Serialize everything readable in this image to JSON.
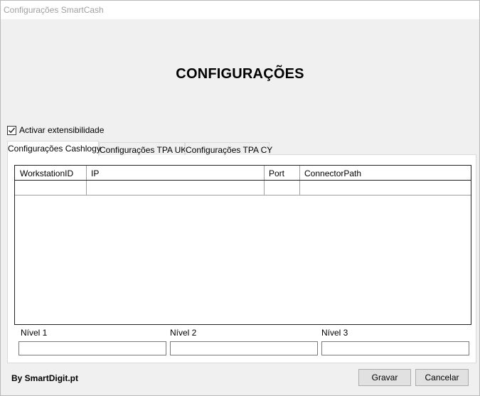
{
  "window": {
    "title": "Configurações SmartCash"
  },
  "heading": "CONFIGURAÇÕES",
  "extensibility": {
    "label": "Activar extensibilidade",
    "checked": true
  },
  "tabs": [
    {
      "label": "Configurações Cashlogy",
      "active": true
    },
    {
      "label": "Configurações TPA UK",
      "active": false
    },
    {
      "label": "Configurações TPA CY",
      "active": false
    }
  ],
  "grid": {
    "columns": [
      "WorkstationID",
      "IP",
      "Port",
      "ConnectorPath"
    ],
    "rows": [
      [
        "",
        "",
        "",
        ""
      ]
    ]
  },
  "levels": [
    {
      "label": "Nível 1",
      "value": ""
    },
    {
      "label": "Nível 2",
      "value": ""
    },
    {
      "label": "Nível 3",
      "value": ""
    }
  ],
  "footer": {
    "credit": "By SmartDigit.pt",
    "save_label": "Gravar",
    "cancel_label": "Cancelar"
  }
}
